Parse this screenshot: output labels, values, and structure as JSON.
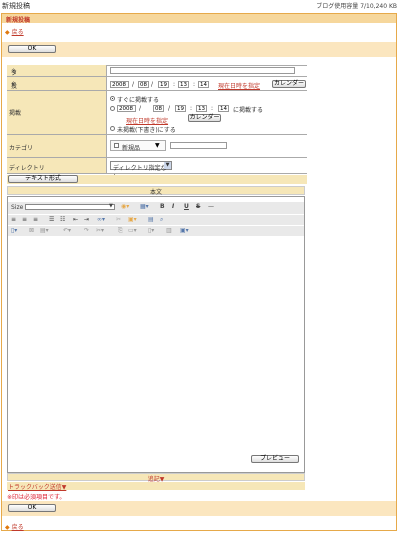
{
  "header": {
    "title": "新規投稿",
    "usage": "ブログ使用容量 7/10,240 KB"
  },
  "section_title": "新規投稿",
  "back_label": "戻る",
  "ok_label": "OK",
  "fields": {
    "title_label": "タイトル",
    "required_mark": "※",
    "post_date_label": "投稿日時",
    "post_date": {
      "year": "2008",
      "month": "08",
      "day": "19",
      "hour": "13",
      "minute": "14",
      "sep_date": "/",
      "sep_time": ":"
    },
    "set_now_label": "現在日時を指定",
    "calendar_label": "カレンダー",
    "publish_label": "掲載",
    "publish_now": "すぐに掲載する",
    "publish_at_suffix": "に掲載する",
    "publish_date": {
      "year": "2008",
      "month": "08",
      "day": "19",
      "hour": "13",
      "minute": "14"
    },
    "publish_draft": "未掲載(下書き)にする",
    "category_label": "カテゴリ",
    "new_item_label": "新規品",
    "directory_label": "ディレクトリ",
    "directory_value": "ディレクトリ指定なし"
  },
  "text_format_button": "テキスト形式",
  "body_header": "本文",
  "editor": {
    "size_label": "Size"
  },
  "preview_label": "プレビュー",
  "append_label": "追記▼",
  "trackback_label": "トラックバック送信▼",
  "required_note": "※印は必須項目です。",
  "colors": {
    "accent": "#e6a94a",
    "header_bg": "#f6d79c",
    "label_bg": "#f6e7b8",
    "link": "#c0392b"
  }
}
